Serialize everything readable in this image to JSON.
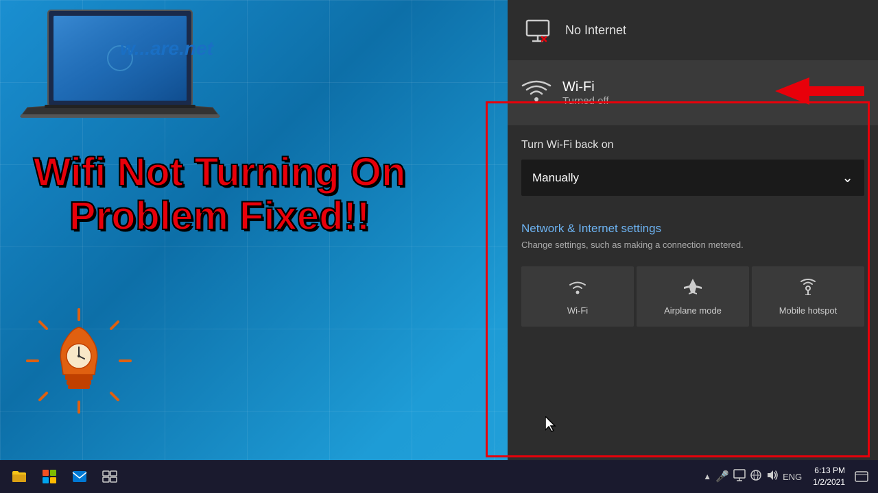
{
  "desktop": {
    "background_color": "#1a8fd1"
  },
  "left_panel": {
    "website_url": "w...are.net",
    "title_line1": "Wifi Not Turning On",
    "title_line2": "Problem Fixed!!"
  },
  "network_panel": {
    "no_internet": {
      "icon": "monitor-icon",
      "text": "No Internet"
    },
    "wifi_section": {
      "icon": "wifi-icon",
      "name": "Wi-Fi",
      "status": "Turned off"
    },
    "turn_wifi": {
      "label": "Turn Wi-Fi back on",
      "dropdown_value": "Manually",
      "dropdown_icon": "chevron-down-icon"
    },
    "network_settings": {
      "title": "Network & Internet settings",
      "description": "Change settings, such as making a connection metered."
    },
    "quick_tiles": [
      {
        "icon": "wifi-tile-icon",
        "label": "Wi-Fi"
      },
      {
        "icon": "airplane-icon",
        "label": "Airplane mode"
      },
      {
        "icon": "hotspot-icon",
        "label": "Mobile hotspot"
      }
    ]
  },
  "taskbar": {
    "icons": [
      {
        "name": "file-explorer-icon",
        "symbol": "📁"
      },
      {
        "name": "store-icon",
        "symbol": "🛍"
      },
      {
        "name": "mail-icon",
        "symbol": "✉"
      },
      {
        "name": "settings-icon",
        "symbol": "⊞"
      }
    ],
    "sys_tray": {
      "chevron": "^",
      "mic_icon": "🎤",
      "display_icon": "🖥",
      "globe_icon": "🌐",
      "volume_icon": "🔊",
      "language": "ENG",
      "time": "6:13 PM",
      "date": "1/2/2021",
      "notification_icon": "🗨"
    }
  }
}
